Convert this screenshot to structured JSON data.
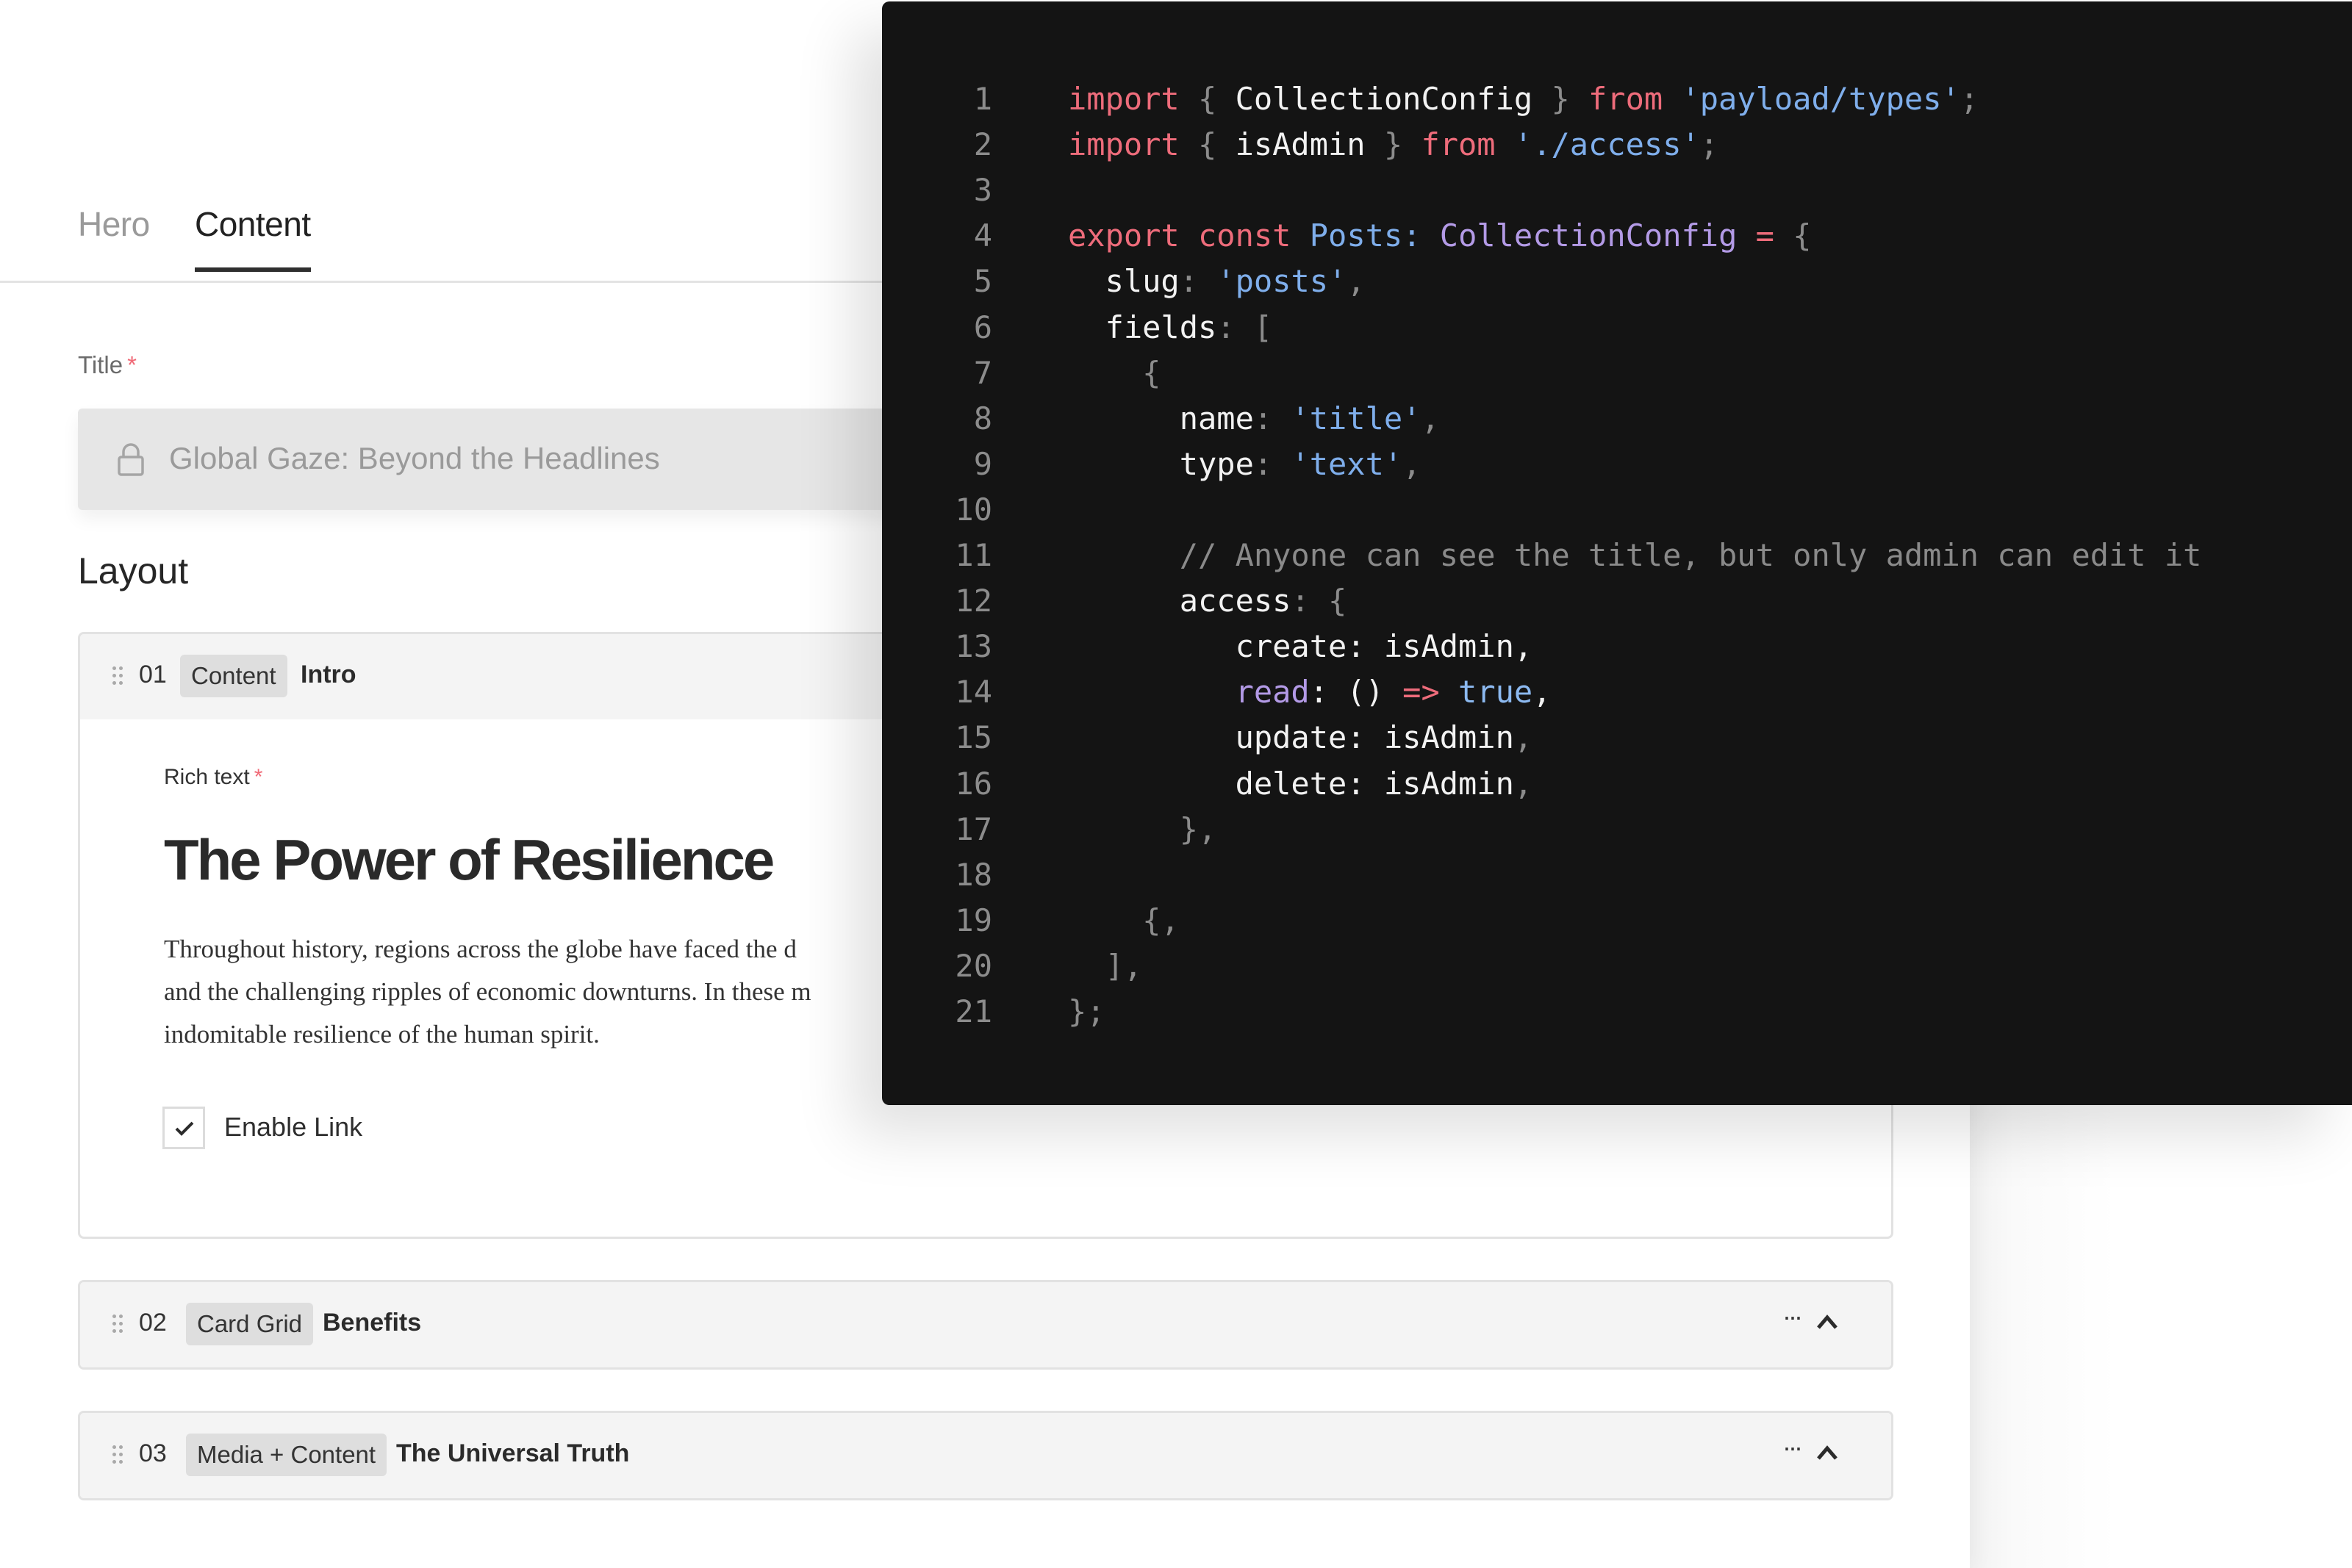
{
  "tabs": [
    {
      "label": "Hero",
      "active": false
    },
    {
      "label": "Content",
      "active": true
    }
  ],
  "title_field": {
    "label": "Title",
    "required_mark": "*",
    "value": "Global Gaze: Beyond the Headlines",
    "locked": true
  },
  "layout": {
    "heading": "Layout",
    "blocks": [
      {
        "number": "01",
        "type": "Content",
        "title": "Intro",
        "expanded": true,
        "rich_text": {
          "label": "Rich text",
          "required_mark": "*",
          "heading": "The Power of Resilience",
          "paragraph_lines": [
            "Throughout history, regions across the globe have faced the d",
            "and the challenging ripples of economic downturns. In these m",
            "indomitable resilience of the human spirit."
          ]
        },
        "enable_link": {
          "label": "Enable Link",
          "checked": true
        }
      },
      {
        "number": "02",
        "type": "Card Grid",
        "title": "Benefits",
        "more_label": "···",
        "collapse_icon": "chevron-up-icon"
      },
      {
        "number": "03",
        "type": "Media + Content",
        "title": "The Universal Truth",
        "more_label": "···",
        "collapse_icon": "chevron-up-icon"
      }
    ]
  },
  "code": {
    "colors": {
      "keyword": "#ee6c7b",
      "string": "#7faeeb",
      "type": "#b39ae6",
      "identifier": "#f2f2f2",
      "punctuation": "#8c8c8c",
      "comment": "#8a8a8a",
      "background": "#141414"
    },
    "lines": [
      {
        "n": "1",
        "tokens": [
          [
            "kw",
            "import"
          ],
          [
            "pn",
            " { "
          ],
          [
            "id",
            "CollectionConfig"
          ],
          [
            "pn",
            " } "
          ],
          [
            "kw",
            "from"
          ],
          [
            "pn",
            " "
          ],
          [
            "str",
            "'payload/types'"
          ],
          [
            "pn",
            ";"
          ]
        ]
      },
      {
        "n": "2",
        "tokens": [
          [
            "kw",
            "import"
          ],
          [
            "pn",
            " { "
          ],
          [
            "id",
            "isAdmin"
          ],
          [
            "pn",
            " } "
          ],
          [
            "kw",
            "from"
          ],
          [
            "pn",
            " "
          ],
          [
            "str",
            "'./access'"
          ],
          [
            "pn",
            ";"
          ]
        ]
      },
      {
        "n": "3",
        "tokens": []
      },
      {
        "n": "4",
        "tokens": [
          [
            "kw",
            "export"
          ],
          [
            "pn",
            " "
          ],
          [
            "kw",
            "const"
          ],
          [
            "pn",
            " "
          ],
          [
            "str",
            "Posts"
          ],
          [
            "str",
            ":"
          ],
          [
            "pn",
            " "
          ],
          [
            "typ",
            "CollectionConfig"
          ],
          [
            "pn",
            " "
          ],
          [
            "kw",
            "="
          ],
          [
            "pn",
            " {"
          ]
        ]
      },
      {
        "n": "5",
        "tokens": [
          [
            "pn",
            "  "
          ],
          [
            "id",
            "slug"
          ],
          [
            "pn",
            ": "
          ],
          [
            "str",
            "'posts'"
          ],
          [
            "pn",
            ","
          ]
        ]
      },
      {
        "n": "6",
        "tokens": [
          [
            "pn",
            "  "
          ],
          [
            "id",
            "fields"
          ],
          [
            "pn",
            ": ["
          ]
        ]
      },
      {
        "n": "7",
        "tokens": [
          [
            "pn",
            "    {"
          ]
        ]
      },
      {
        "n": "8",
        "tokens": [
          [
            "pn",
            "      "
          ],
          [
            "id",
            "name"
          ],
          [
            "pn",
            ": "
          ],
          [
            "str",
            "'title'"
          ],
          [
            "pn",
            ","
          ]
        ]
      },
      {
        "n": "9",
        "tokens": [
          [
            "pn",
            "      "
          ],
          [
            "id",
            "type"
          ],
          [
            "pn",
            ": "
          ],
          [
            "str",
            "'text'"
          ],
          [
            "pn",
            ","
          ]
        ]
      },
      {
        "n": "10",
        "tokens": []
      },
      {
        "n": "11",
        "tokens": [
          [
            "cm",
            "      // Anyone can see the title, but only admin can edit it"
          ]
        ]
      },
      {
        "n": "12",
        "tokens": [
          [
            "pn",
            "      "
          ],
          [
            "id",
            "access"
          ],
          [
            "pn",
            ": {"
          ]
        ]
      },
      {
        "n": "13",
        "tokens": [
          [
            "pn",
            "         "
          ],
          [
            "id",
            "create: isAdmin,"
          ]
        ]
      },
      {
        "n": "14",
        "tokens": [
          [
            "pn",
            "         "
          ],
          [
            "typ",
            "read"
          ],
          [
            "id",
            ": () "
          ],
          [
            "kw",
            "=>"
          ],
          [
            "id",
            " "
          ],
          [
            "bool",
            "true"
          ],
          [
            "id",
            ","
          ]
        ]
      },
      {
        "n": "15",
        "tokens": [
          [
            "pn",
            "         "
          ],
          [
            "id",
            "update: isAdmin"
          ],
          [
            "pn",
            ","
          ]
        ]
      },
      {
        "n": "16",
        "tokens": [
          [
            "pn",
            "         "
          ],
          [
            "id",
            "delete: isAdmin"
          ],
          [
            "pn",
            ","
          ]
        ]
      },
      {
        "n": "17",
        "tokens": [
          [
            "pn",
            "      },"
          ]
        ]
      },
      {
        "n": "18",
        "tokens": []
      },
      {
        "n": "19",
        "tokens": [
          [
            "pn",
            "    {,"
          ]
        ]
      },
      {
        "n": "20",
        "tokens": [
          [
            "pn",
            "  ],"
          ]
        ]
      },
      {
        "n": "21",
        "tokens": [
          [
            "pn",
            "};"
          ]
        ]
      }
    ]
  }
}
